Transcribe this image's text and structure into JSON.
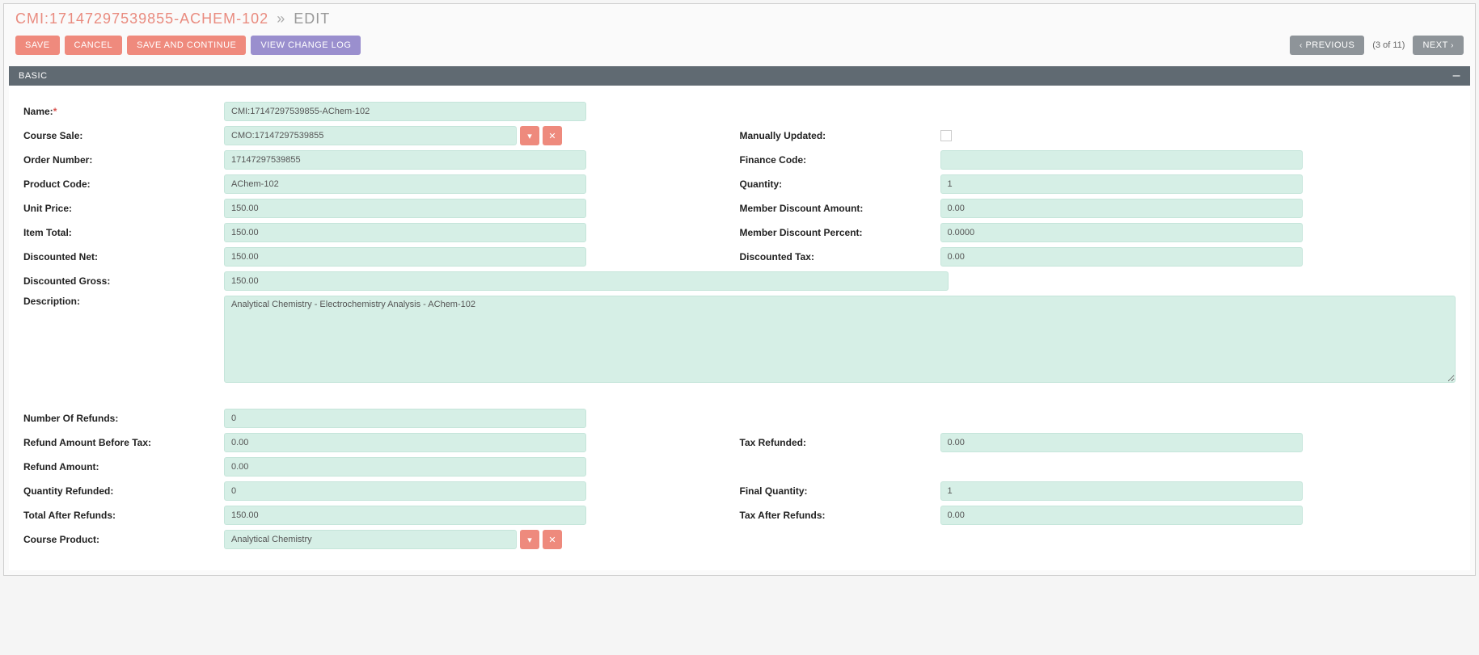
{
  "header": {
    "title": "CMI:17147297539855-ACHEM-102",
    "separator": "»",
    "mode": "EDIT"
  },
  "toolbar": {
    "save": "SAVE",
    "cancel": "CANCEL",
    "save_continue": "SAVE AND CONTINUE",
    "view_log": "VIEW CHANGE LOG",
    "previous": "PREVIOUS",
    "pager": "(3 of 11)",
    "next": "NEXT"
  },
  "section": {
    "title": "BASIC",
    "collapse_glyph": "–"
  },
  "labels": {
    "name": "Name:",
    "course_sale": "Course Sale:",
    "manually_updated": "Manually Updated:",
    "order_number": "Order Number:",
    "finance_code": "Finance Code:",
    "product_code": "Product Code:",
    "quantity": "Quantity:",
    "unit_price": "Unit Price:",
    "member_discount_amount": "Member Discount Amount:",
    "item_total": "Item Total:",
    "member_discount_percent": "Member Discount Percent:",
    "discounted_net": "Discounted Net:",
    "discounted_tax": "Discounted Tax:",
    "discounted_gross": "Discounted Gross:",
    "description": "Description:",
    "number_refunds": "Number Of Refunds:",
    "refund_before_tax": "Refund Amount Before Tax:",
    "tax_refunded": "Tax Refunded:",
    "refund_amount": "Refund Amount:",
    "quantity_refunded": "Quantity Refunded:",
    "final_quantity": "Final Quantity:",
    "total_after_refunds": "Total After Refunds:",
    "tax_after_refunds": "Tax After Refunds:",
    "course_product": "Course Product:"
  },
  "values": {
    "name": "CMI:17147297539855-AChem-102",
    "course_sale": "CMO:17147297539855",
    "order_number": "17147297539855",
    "finance_code": "",
    "product_code": "AChem-102",
    "quantity": "1",
    "unit_price": "150.00",
    "member_discount_amount": "0.00",
    "item_total": "150.00",
    "member_discount_percent": "0.0000",
    "discounted_net": "150.00",
    "discounted_tax": "0.00",
    "discounted_gross": "150.00",
    "description": "Analytical Chemistry - Electrochemistry Analysis - AChem-102",
    "number_refunds": "0",
    "refund_before_tax": "0.00",
    "tax_refunded": "0.00",
    "refund_amount": "0.00",
    "quantity_refunded": "0",
    "final_quantity": "1",
    "total_after_refunds": "150.00",
    "tax_after_refunds": "0.00",
    "course_product": "Analytical Chemistry"
  },
  "icons": {
    "pin": "◣",
    "clear": "✕",
    "chev_left": "‹",
    "chev_right": "›"
  }
}
